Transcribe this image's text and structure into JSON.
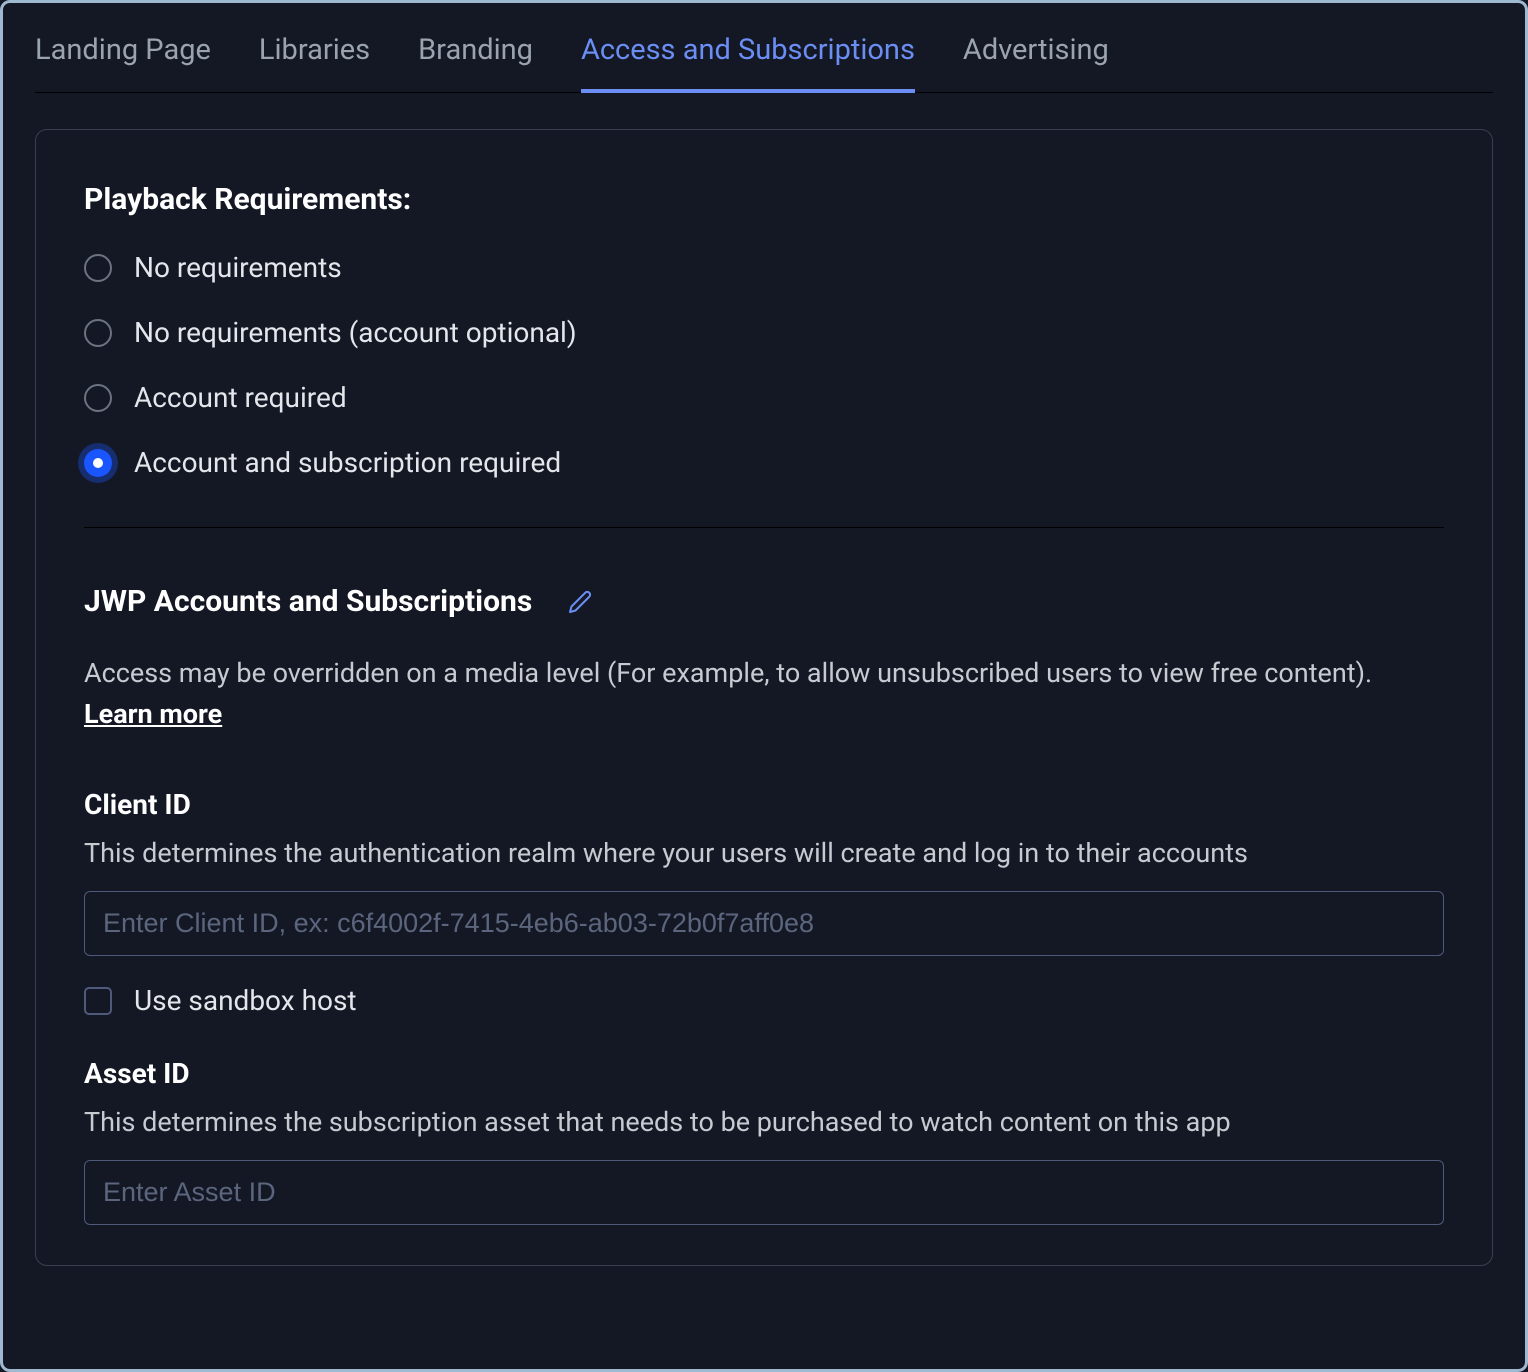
{
  "tabs": [
    {
      "label": "Landing Page",
      "active": false
    },
    {
      "label": "Libraries",
      "active": false
    },
    {
      "label": "Branding",
      "active": false
    },
    {
      "label": "Access and Subscriptions",
      "active": true
    },
    {
      "label": "Advertising",
      "active": false
    }
  ],
  "playback": {
    "title": "Playback Requirements:",
    "options": [
      {
        "label": "No requirements",
        "selected": false
      },
      {
        "label": "No requirements (account optional)",
        "selected": false
      },
      {
        "label": "Account required",
        "selected": false
      },
      {
        "label": "Account and subscription required",
        "selected": true
      }
    ]
  },
  "jwp": {
    "title": "JWP Accounts and Subscriptions",
    "description": "Access may be overridden on a media level (For example, to allow unsubscribed users to view free content).",
    "learn_more": "Learn more",
    "client_id": {
      "label": "Client ID",
      "help": "This determines the authentication realm where your users will create and log in to their accounts",
      "placeholder": "Enter Client ID, ex: c6f4002f-7415-4eb6-ab03-72b0f7aff0e8",
      "value": ""
    },
    "sandbox": {
      "label": "Use sandbox host",
      "checked": false
    },
    "asset_id": {
      "label": "Asset ID",
      "help": "This determines the subscription asset that needs to be purchased to watch content on this app",
      "placeholder": "Enter Asset ID",
      "value": ""
    }
  }
}
